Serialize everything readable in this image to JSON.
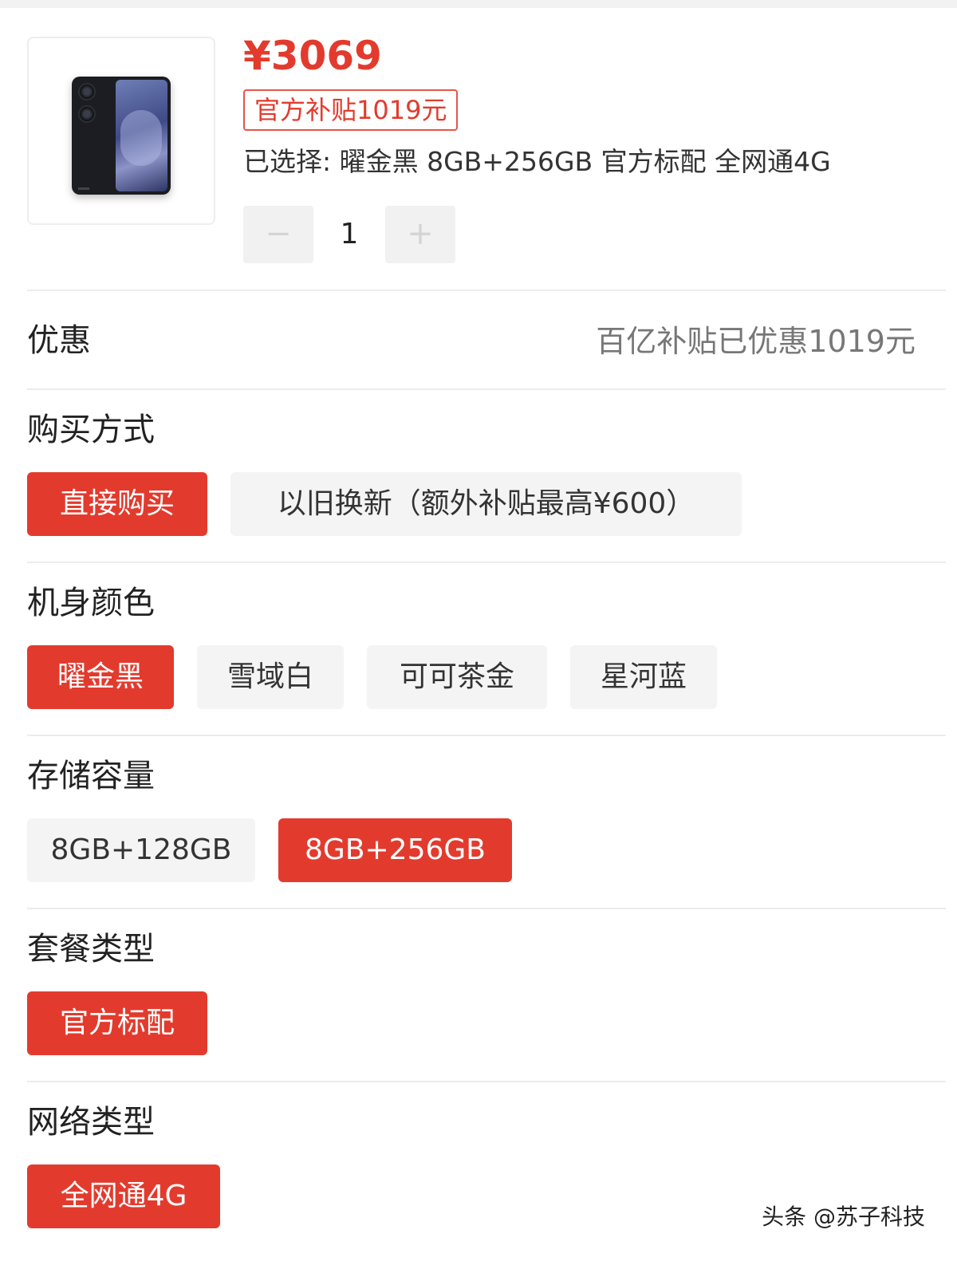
{
  "product": {
    "price": "¥3069",
    "subsidy_tag": "官方补贴1019元",
    "selected_summary": "已选择: 曜金黑 8GB+256GB 官方标配 全网通4G",
    "quantity": "1",
    "qty_minus": "−",
    "qty_plus": "+"
  },
  "discount": {
    "label": "优惠",
    "value": "百亿补贴已优惠1019元"
  },
  "purchase_method": {
    "title": "购买方式",
    "options": [
      {
        "label": "直接购买",
        "selected": true
      },
      {
        "label": "以旧换新（额外补贴最高¥600）",
        "selected": false
      }
    ]
  },
  "color": {
    "title": "机身颜色",
    "options": [
      {
        "label": "曜金黑",
        "selected": true
      },
      {
        "label": "雪域白",
        "selected": false
      },
      {
        "label": "可可茶金",
        "selected": false
      },
      {
        "label": "星河蓝",
        "selected": false
      }
    ]
  },
  "storage": {
    "title": "存储容量",
    "options": [
      {
        "label": "8GB+128GB",
        "selected": false
      },
      {
        "label": "8GB+256GB",
        "selected": true
      }
    ]
  },
  "package": {
    "title": "套餐类型",
    "options": [
      {
        "label": "官方标配",
        "selected": true
      }
    ]
  },
  "network": {
    "title": "网络类型",
    "options": [
      {
        "label": "全网通4G",
        "selected": true
      }
    ]
  },
  "watermark": "头条 @苏子科技",
  "colors": {
    "accent": "#e23b2e",
    "option_bg": "#f4f4f4",
    "divider": "#ececec"
  }
}
